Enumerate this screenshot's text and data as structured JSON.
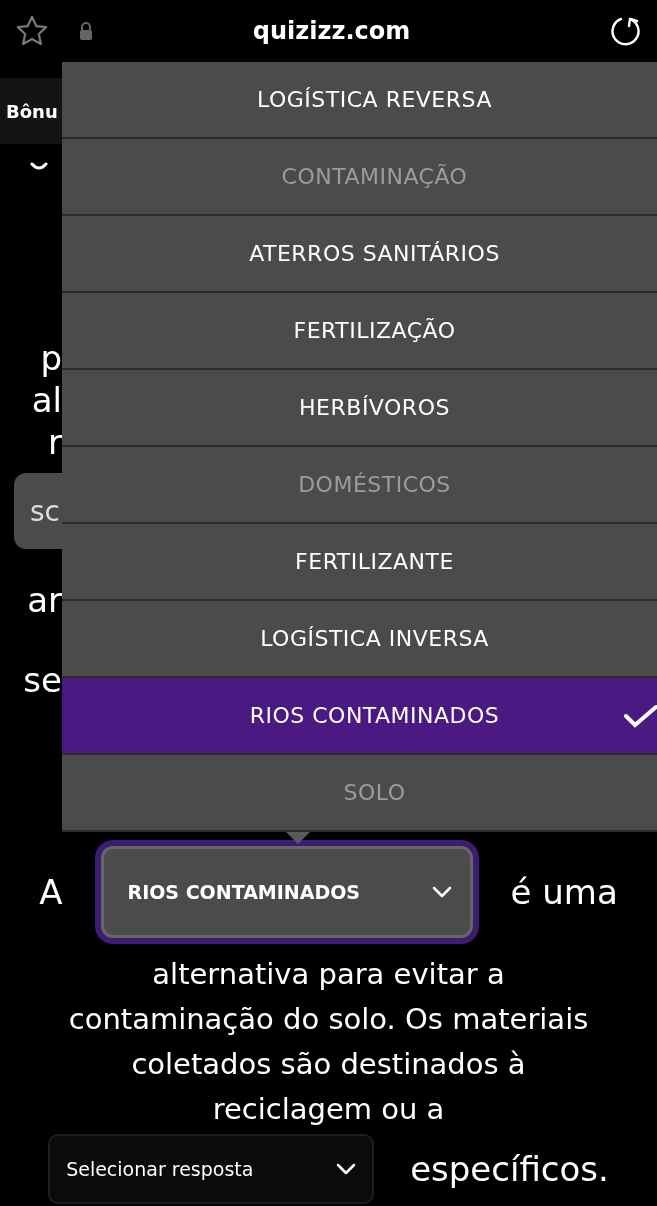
{
  "browser": {
    "url": "quizizz.com"
  },
  "background_fragments": [
    {
      "kind": "header",
      "text": "Bônu"
    },
    {
      "kind": "text",
      "text": "p"
    },
    {
      "kind": "text",
      "text": "al"
    },
    {
      "kind": "text",
      "text": "r"
    },
    {
      "kind": "chip",
      "text": "sc"
    },
    {
      "kind": "text",
      "text": "ar"
    },
    {
      "kind": "text",
      "text": "se"
    }
  ],
  "menu": {
    "options": [
      {
        "label": "LOGÍSTICA REVERSA",
        "disabled": false,
        "selected": false
      },
      {
        "label": "CONTAMINAÇÃO",
        "disabled": true,
        "selected": false
      },
      {
        "label": "ATERROS SANITÁRIOS",
        "disabled": false,
        "selected": false
      },
      {
        "label": "FERTILIZAÇÃO",
        "disabled": false,
        "selected": false
      },
      {
        "label": "HERBÍVOROS",
        "disabled": false,
        "selected": false
      },
      {
        "label": "DOMÉSTICOS",
        "disabled": true,
        "selected": false
      },
      {
        "label": "FERTILIZANTE",
        "disabled": false,
        "selected": false
      },
      {
        "label": "LOGÍSTICA INVERSA",
        "disabled": false,
        "selected": false
      },
      {
        "label": "RIOS CONTAMINADOS",
        "disabled": false,
        "selected": true
      },
      {
        "label": "SOLO",
        "disabled": true,
        "selected": false
      }
    ]
  },
  "question": {
    "prefix": "A",
    "blank_1": {
      "value": "RIOS CONTAMINADOS",
      "open": true
    },
    "after_blank_1": "é uma",
    "lines": [
      "alternativa para evitar a",
      "contaminação do solo. Os materiais",
      "coletados são destinados à",
      "reciclagem ou a"
    ],
    "blank_2": {
      "placeholder": "Selecionar resposta",
      "open": false
    },
    "suffix": "específicos."
  }
}
